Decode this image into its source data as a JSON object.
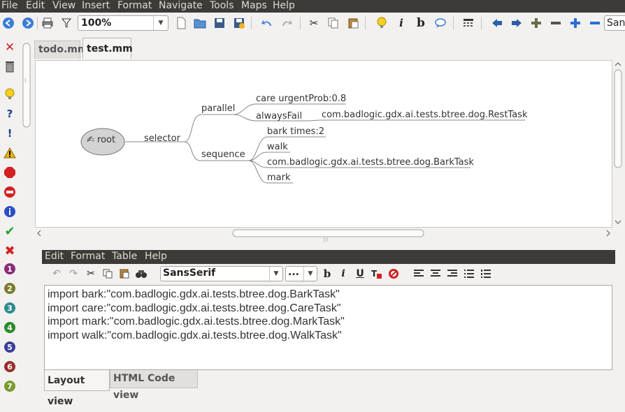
{
  "menubar": {
    "items": [
      {
        "label": "File",
        "key": "file"
      },
      {
        "label": "Edit",
        "key": "edit"
      },
      {
        "label": "View",
        "key": "view"
      },
      {
        "label": "Insert",
        "key": "insert"
      },
      {
        "label": "Format",
        "key": "format"
      },
      {
        "label": "Navigate",
        "key": "navigate"
      },
      {
        "label": "Tools",
        "key": "tools"
      },
      {
        "label": "Maps",
        "key": "maps"
      },
      {
        "label": "Help",
        "key": "help"
      }
    ]
  },
  "toolbar": {
    "zoom_value": "100%",
    "font_value": "San"
  },
  "tabs": [
    {
      "label": "todo.mm",
      "active": false
    },
    {
      "label": "test.mm",
      "active": true
    }
  ],
  "mindmap": {
    "root": "root",
    "selector": "selector",
    "parallel": "parallel",
    "sequence": "sequence",
    "care": "care urgentProb:0.8",
    "alwaysFail": "alwaysFail",
    "restTask": "com.badlogic.gdx.ai.tests.btree.dog.RestTask",
    "bark": "bark times:2",
    "walk": "walk",
    "barkTask": "com.badlogic.gdx.ai.tests.btree.dog.BarkTask",
    "mark": "mark"
  },
  "editor": {
    "menu": [
      "Edit",
      "Format",
      "Table",
      "Help"
    ],
    "font_family": "SansSerif",
    "font_size": "...",
    "lines": [
      "import bark:\"com.badlogic.gdx.ai.tests.btree.dog.BarkTask\"",
      "import care:\"com.badlogic.gdx.ai.tests.btree.dog.CareTask\"",
      "import mark:\"com.badlogic.gdx.ai.tests.btree.dog.MarkTask\"",
      "import walk:\"com.badlogic.gdx.ai.tests.btree.dog.WalkTask\""
    ],
    "view_tabs": [
      "Layout view",
      "HTML Code view"
    ]
  },
  "colors": {
    "menubar_bg": "#3c3b37",
    "edge": "#8a8a8a",
    "root_fill": "#d3d3d3"
  }
}
